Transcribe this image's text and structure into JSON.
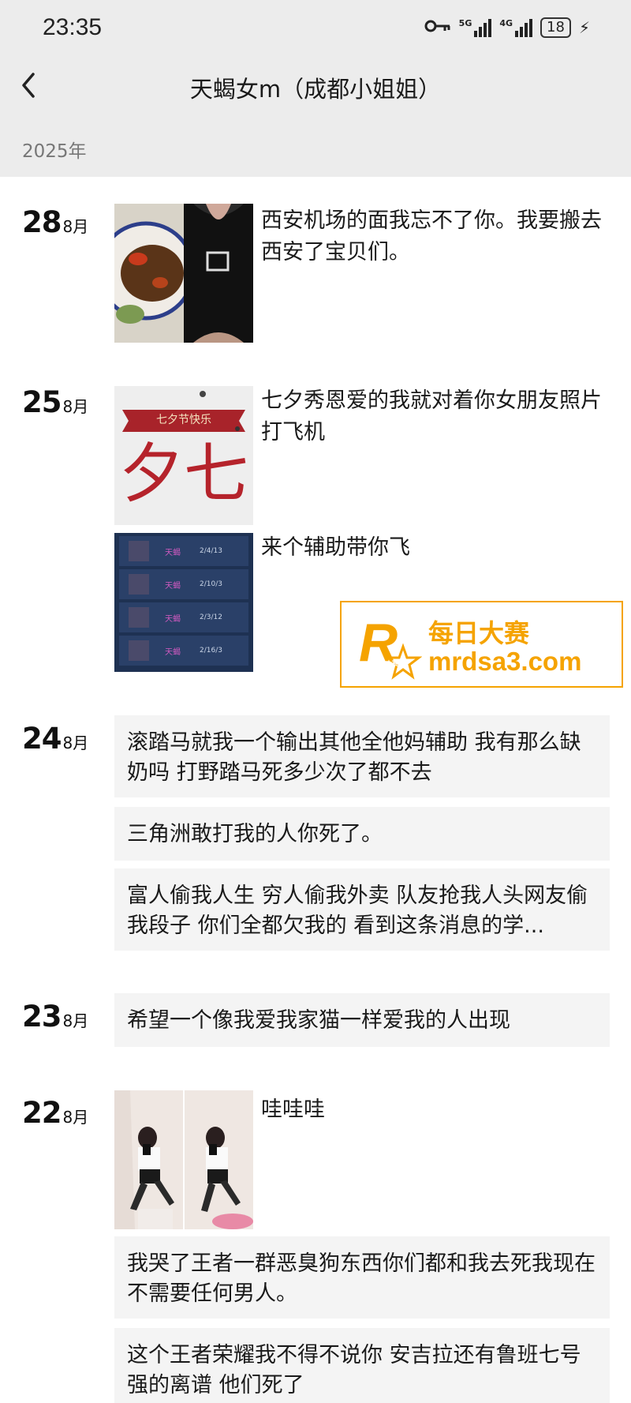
{
  "status": {
    "time": "23:35",
    "net1": "5G",
    "net2": "4G",
    "battery": "18"
  },
  "header": {
    "title": "天蝎女m（成都小姐姐）",
    "year": "2025年"
  },
  "month_label": "8月",
  "days": [
    {
      "day": "28",
      "captions": [
        "西安机场的面我忘不了你。我要搬去西安了宝贝们。"
      ]
    },
    {
      "day": "25",
      "captions": [
        "七夕秀恩爱的我就对着你女朋友照片打飞机",
        "来个辅助带你飞"
      ],
      "card_banner": "七夕节快乐",
      "card_big": "夕七"
    },
    {
      "day": "24",
      "posts": [
        "滚踏马就我一个输出其他全他妈辅助 我有那么缺奶吗 打野踏马死多少次了都不去",
        "三角洲敢打我的人你死了。",
        "富人偷我人生 穷人偷我外卖 队友抢我人头网友偷我段子 你们全都欠我的 看到这条消息的学..."
      ]
    },
    {
      "day": "23",
      "posts": [
        "希望一个像我爱我家猫一样爱我的人出现"
      ]
    },
    {
      "day": "22",
      "captions": [
        "哇哇哇"
      ],
      "posts": [
        "我哭了王者一群恶臭狗东西你们都和我去死我现在不需要任何男人。",
        "这个王者荣耀我不得不说你 安吉拉还有鲁班七号强的离谱 他们死了"
      ]
    }
  ],
  "watermark": {
    "name": "每日大赛",
    "url": "mrdsa3.com",
    "logo_small": "每日大赛"
  },
  "game_rows": [
    {
      "name": "天蝎",
      "stat": "2/4/13"
    },
    {
      "name": "天蝎",
      "stat": "2/10/3"
    },
    {
      "name": "天蝎",
      "stat": "2/3/12"
    },
    {
      "name": "天蝎",
      "stat": "2/16/3"
    }
  ],
  "colors": {
    "accent": "#f5a300",
    "bubble": "#f4f4f4",
    "header": "#ececec"
  }
}
